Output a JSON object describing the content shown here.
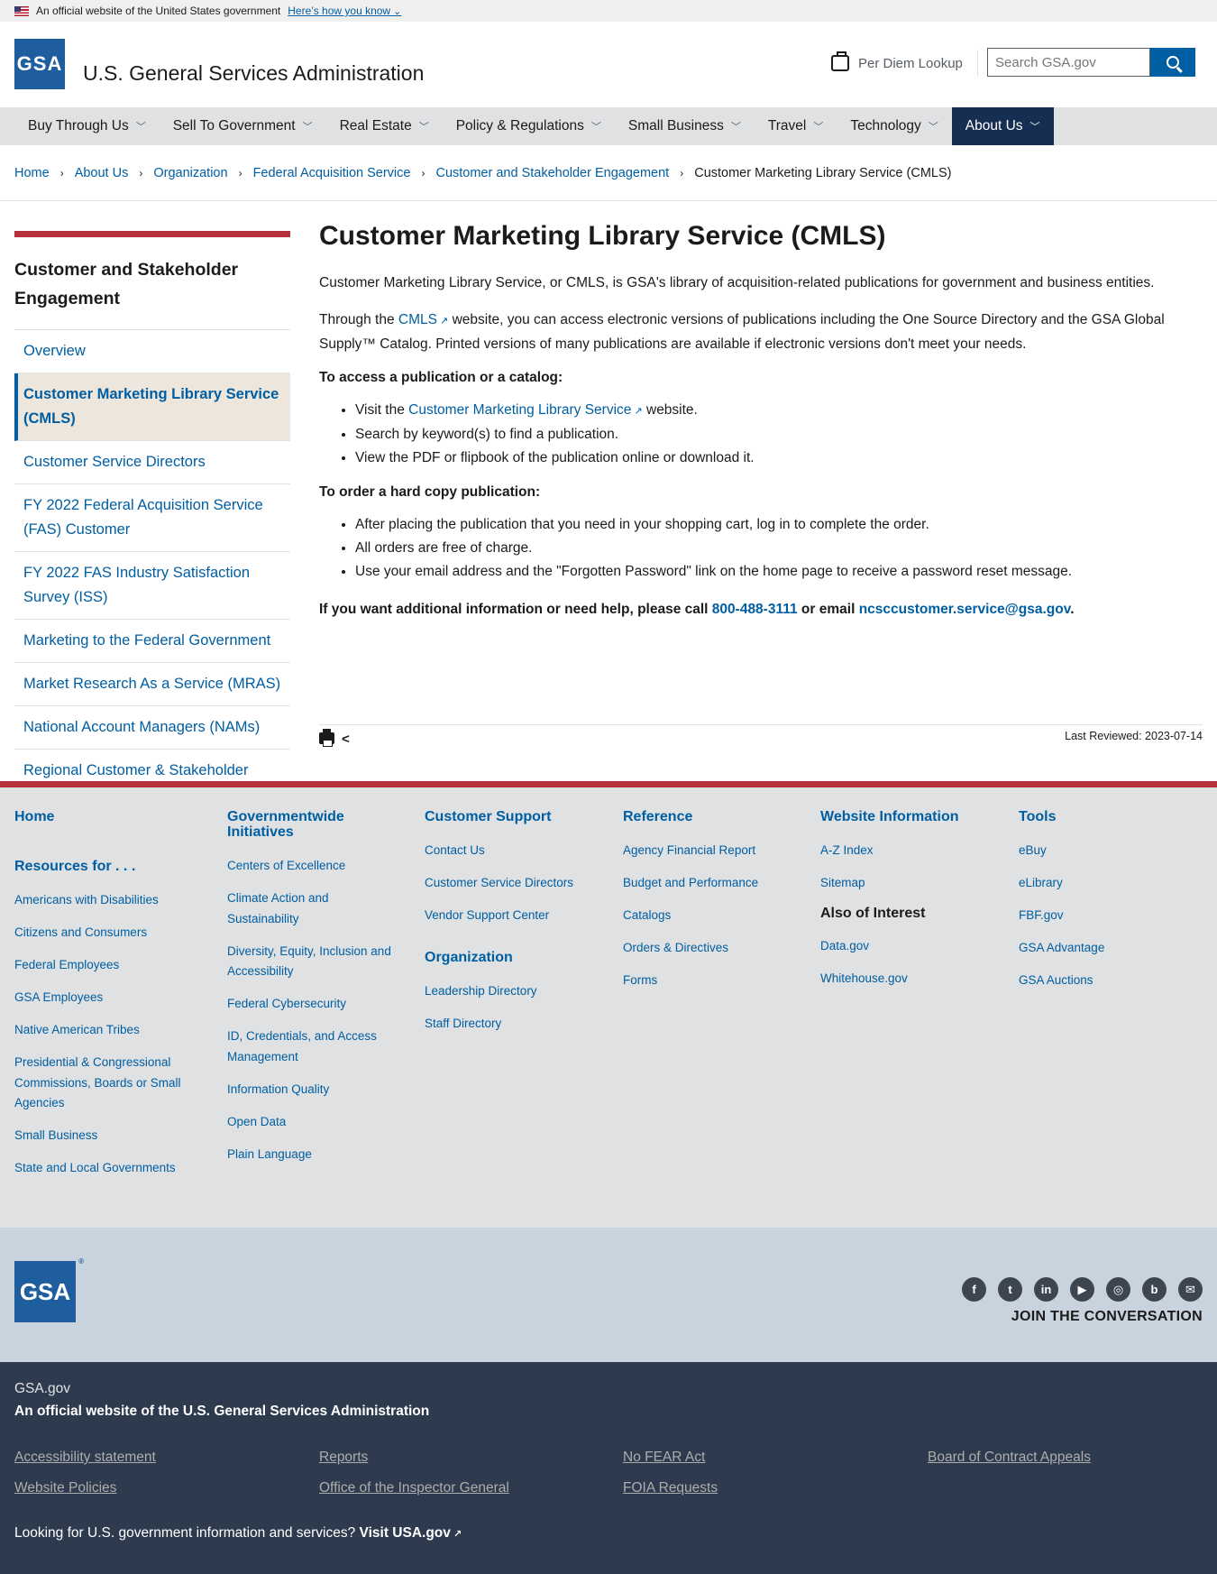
{
  "banner": {
    "text": "An official website of the United States government",
    "link": "Here’s how you know"
  },
  "header": {
    "logo": "GSA",
    "title": "U.S. General Services Administration",
    "per_diem": "Per Diem Lookup",
    "search_placeholder": "Search GSA.gov"
  },
  "nav": [
    {
      "label": "Buy Through Us"
    },
    {
      "label": "Sell To Government"
    },
    {
      "label": "Real Estate"
    },
    {
      "label": "Policy & Regulations"
    },
    {
      "label": "Small Business"
    },
    {
      "label": "Travel"
    },
    {
      "label": "Technology"
    },
    {
      "label": "About Us"
    }
  ],
  "breadcrumb": {
    "items": [
      "Home",
      "About Us",
      "Organization",
      "Federal Acquisition Service",
      "Customer and Stakeholder Engagement"
    ],
    "current": "Customer Marketing Library Service (CMLS)"
  },
  "sidebar": {
    "heading": "Customer and Stakeholder Engagement",
    "items": [
      "Overview",
      "Customer Marketing Library Service (CMLS)",
      "Customer Service Directors",
      "FY 2022 Federal Acquisition Service (FAS) Customer",
      "FY 2022 FAS Industry Satisfaction Survey (ISS)",
      "Marketing to the Federal Government",
      "Market Research As a Service (MRAS)",
      "National Account Managers (NAMs)",
      "Regional Customer & Stakeholder Engagement Dirs."
    ]
  },
  "main": {
    "title": "Customer Marketing Library Service (CMLS)",
    "intro": "Customer Marketing Library Service, or CMLS, is GSA's library of acquisition-related publications for government and business entities.",
    "p2_before": "Through the ",
    "p2_link": "CMLS",
    "p2_after": " website, you can access electronic versions of publications including the One Source Directory and the GSA Global Supply™ Catalog. Printed versions of many publications are available if electronic versions don't meet your needs.",
    "access_heading": "To access a publication or a catalog:",
    "access_li1_before": "Visit the ",
    "access_li1_link": "Customer Marketing Library Service",
    "access_li1_after": " website.",
    "access_li2": "Search by keyword(s) to find a publication.",
    "access_li3": "View the PDF or flipbook of the publication online or download it.",
    "order_heading": "To order a hard copy publication:",
    "order_li1": "After placing the publication that you need in your shopping cart, log in to complete the order.",
    "order_li2": "All orders are free of charge.",
    "order_li3": "Use your email address and the \"Forgotten Password\" link on the home page to receive a password reset message.",
    "help_before": "If you want additional information or need help, please call ",
    "help_phone": "800-488-3111",
    "help_mid": " or email ",
    "help_email": "ncsccustomer.service@gsa.gov",
    "help_end": ".",
    "last_reviewed": "Last Reviewed: 2023-07-14"
  },
  "footer": {
    "col1": {
      "home": "Home",
      "resources_heading": "Resources for . . .",
      "links": [
        "Americans with Disabilities",
        "Citizens and Consumers",
        "Federal Employees",
        "GSA Employees",
        "Native American Tribes",
        "Presidential & Congressional Commissions, Boards or Small Agencies",
        "Small Business",
        "State and Local Governments"
      ]
    },
    "col2": {
      "heading": "Governmentwide Initiatives",
      "links": [
        "Centers of Excellence",
        "Climate Action and Sustainability",
        "Diversity, Equity, Inclusion and Accessibility",
        "Federal Cybersecurity",
        "ID, Credentials, and Access Management",
        "Information Quality",
        "Open Data",
        "Plain Language"
      ]
    },
    "col3": {
      "heading": "Customer Support",
      "links": [
        "Contact Us",
        "Customer Service Directors",
        "Vendor Support Center"
      ],
      "heading2": "Organization",
      "links2": [
        "Leadership Directory",
        "Staff Directory"
      ]
    },
    "col4": {
      "heading": "Reference",
      "links": [
        "Agency Financial Report",
        "Budget and Performance",
        "Catalogs",
        "Orders & Directives",
        "Forms"
      ]
    },
    "col5": {
      "heading": "Website Information",
      "links": [
        "A-Z Index",
        "Sitemap"
      ],
      "also": "Also of Interest",
      "links2": [
        "Data.gov",
        "Whitehouse.gov"
      ]
    },
    "col6": {
      "heading": "Tools",
      "links": [
        "eBuy",
        "eLibrary",
        "FBF.gov",
        "GSA Advantage",
        "GSA Auctions"
      ]
    },
    "logo": "GSA",
    "join": "JOIN THE CONVERSATION",
    "social": [
      "facebook-icon",
      "twitter-icon",
      "linkedin-icon",
      "youtube-icon",
      "instagram-icon",
      "blog-icon",
      "email-icon"
    ]
  },
  "identifier": {
    "domain": "GSA.gov",
    "official": "An official website of the U.S. General Services Administration",
    "links": [
      "Accessibility statement",
      "Reports",
      "No FEAR Act",
      "Board of Contract Appeals",
      "Website Policies",
      "Office of the Inspector General",
      "FOIA Requests"
    ],
    "usa_text": "Looking for U.S. government information and services? ",
    "usa_link": "Visit USA.gov"
  },
  "colors": {
    "primary": "#005ea2",
    "navy": "#162e51",
    "accent_red": "#b5323a",
    "footer_bg": "#dfe1e2",
    "identifier_bg": "#2e3b4e"
  }
}
